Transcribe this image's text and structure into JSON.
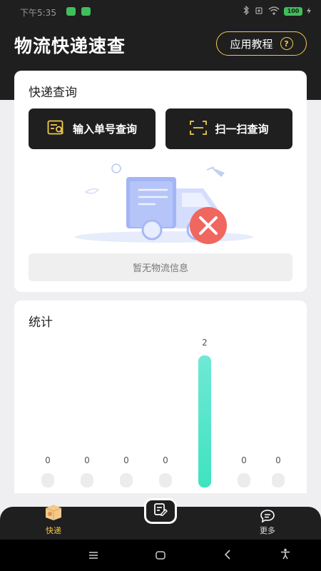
{
  "status_bar": {
    "time": "下午5:35",
    "battery": "100"
  },
  "header": {
    "title": "物流快递速查",
    "tutorial_label": "应用教程",
    "help_symbol": "?"
  },
  "query": {
    "title": "快递查询",
    "input_button": "输入单号查询",
    "scan_button": "扫一扫查询",
    "empty_text": "暂无物流信息"
  },
  "stats": {
    "title": "统计"
  },
  "chart_data": {
    "type": "bar",
    "categories": [
      "",
      "",
      "",
      "",
      "",
      "",
      ""
    ],
    "values": [
      0,
      0,
      0,
      0,
      2,
      0,
      0
    ],
    "ylim": [
      0,
      2
    ],
    "grid": false,
    "highlight_color": "#4ee0c4"
  },
  "tabbar": {
    "express_label": "快递",
    "more_label": "更多"
  },
  "colors": {
    "header_bg": "#1f1f1f",
    "accent": "#f2c94c",
    "teal": "#4ee0c4"
  }
}
